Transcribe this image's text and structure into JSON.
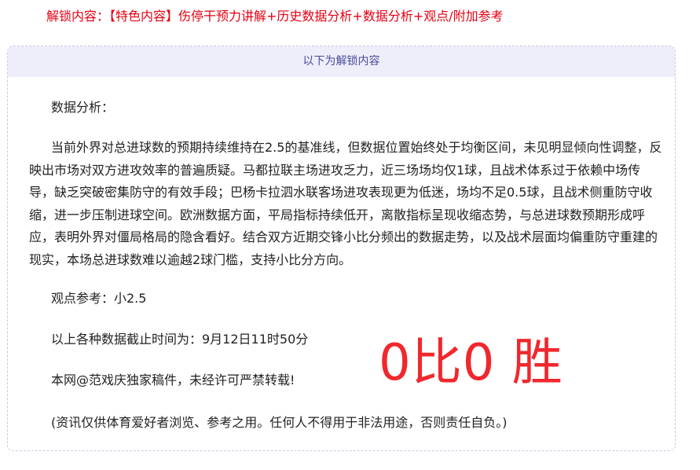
{
  "unlock": {
    "label": "解锁内容：",
    "content": "【特色内容】伤停干预力讲解+历史数据分析+数据分析+观点/附加参考"
  },
  "box": {
    "header": "以下为解锁内容",
    "section_title": "数据分析：",
    "body": "当前外界对总进球数的预期持续维持在2.5的基准线，但数据位置始终处于均衡区间，未见明显倾向性调整，反映出市场对双方进攻效率的普遍质疑。马都拉联主场进攻乏力，近三场场均仅1球，且战术体系过于依赖中场传导，缺乏突破密集防守的有效手段；巴杨卡拉泗水联客场进攻表现更为低迷，场均不足0.5球，且战术侧重防守收缩，进一步压制进球空间。欧洲数据方面，平局指标持续低开，离散指标呈现收缩态势，与总进球数预期形成呼应，表明外界对僵局格局的隐含看好。结合双方近期交锋小比分频出的数据走势，以及战术层面均偏重防守重建的现实，本场总进球数难以逾越2球门槛，支持小比分方向。",
    "viewpoint": "观点参考：小2.5",
    "deadline": "以上各种数据截止时间为：9月12日11时50分",
    "copyright": "本网@范戏庆独家稿件，未经许可严禁转载!",
    "disclaimer": "(资讯仅供体育爱好者浏览、参考之用。任何人不得用于非法用途，否则责任自负。)"
  },
  "overlay": {
    "result": "0比0 胜"
  },
  "colors": {
    "unlock_text": "#e60012",
    "header_bg": "#eeeefa",
    "header_text": "#4a4a9a",
    "border": "#c8c8e0",
    "overlay_text": "#f0282d"
  }
}
